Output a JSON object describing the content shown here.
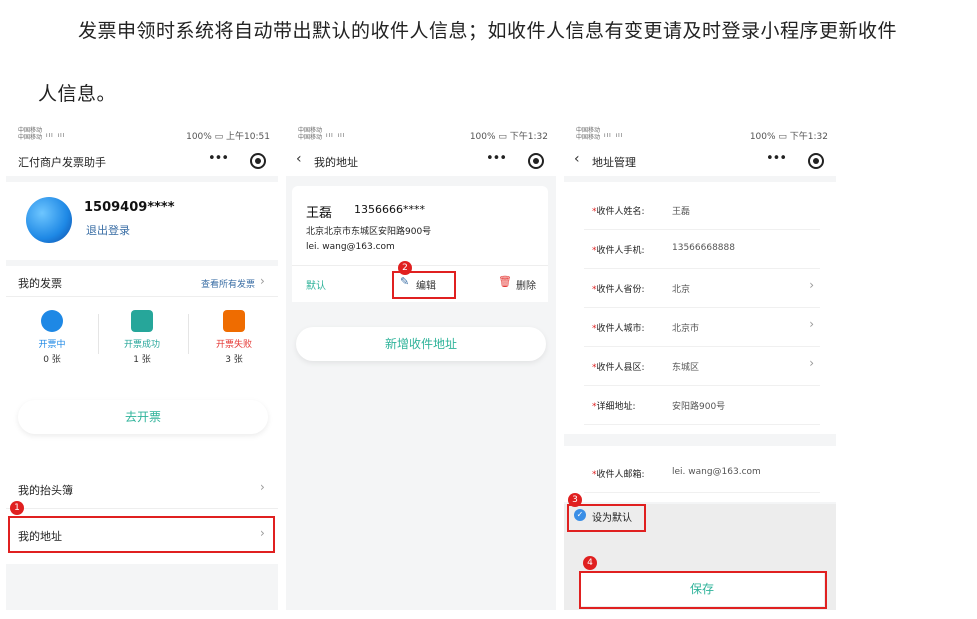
{
  "intro": {
    "line1": "发票申领时系统将自动带出默认的收件人信息；如收件人信息有变更请及时登录小程序更新收件",
    "line2": "人信息。"
  },
  "status_bar": {
    "carrier": "中国移动\n中国移动",
    "signal": "ᵢₗₗ ᵢₗₗ",
    "p1_right": "100% ▭ 上午10:51",
    "p2_right": "100% ▭ 下午1:32",
    "p3_right": "100% ▭ 下午1:32"
  },
  "p1": {
    "title": "汇付商户发票助手",
    "phone": "1509409****",
    "logout": "退出登录",
    "my_invoices": "我的发票",
    "view_all": "查看所有发票",
    "stats": [
      {
        "name": "开票中",
        "count": "0 张",
        "color": "#1e88e5"
      },
      {
        "name": "开票成功",
        "count": "1 张",
        "color": "#26a69a"
      },
      {
        "name": "开票失败",
        "count": "3 张",
        "color": "#ef6c00"
      }
    ],
    "issue_button": "去开票",
    "header_book": "我的抬头簿",
    "my_address": "我的地址"
  },
  "p2": {
    "title": "我的地址",
    "name": "王磊",
    "tel": "1356666****",
    "address": "北京北京市东城区安阳路900号",
    "email": "lei. wang@163.com",
    "default": "默认",
    "edit": "编辑",
    "delete": "删除",
    "add_button": "新增收件地址"
  },
  "p3": {
    "title": "地址管理",
    "fields": [
      {
        "label": "收件人姓名:",
        "value": "王磊",
        "arrow": ""
      },
      {
        "label": "收件人手机:",
        "value": "13566668888",
        "arrow": ""
      },
      {
        "label": "收件人省份:",
        "value": "北京",
        "arrow": "›"
      },
      {
        "label": "收件人城市:",
        "value": "北京市",
        "arrow": "›"
      },
      {
        "label": "收件人县区:",
        "value": "东城区",
        "arrow": "›"
      },
      {
        "label": "详细地址:",
        "value": "安阳路900号",
        "arrow": ""
      }
    ],
    "email_label": "收件人邮箱:",
    "email_value": "lei. wang@163.com",
    "set_default": "设为默认",
    "save": "保存"
  },
  "badges": [
    "1",
    "2",
    "3",
    "4"
  ],
  "colors": {
    "accent_green": "#2fb39a",
    "link_blue": "#3a6ea5",
    "highlight_red": "#e02020"
  }
}
